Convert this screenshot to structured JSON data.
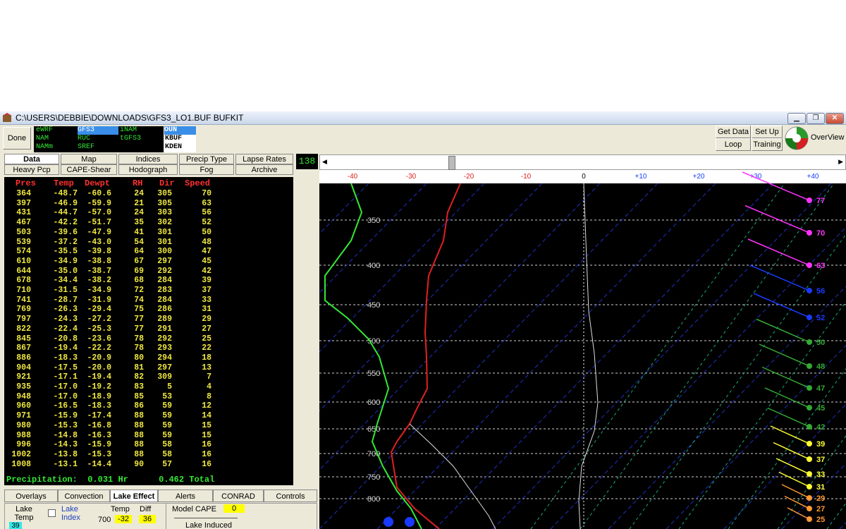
{
  "window": {
    "title": "C:\\USERS\\DEBBIE\\DOWNLOADS\\GFS3_LO1.BUF BUFKIT"
  },
  "toolbar": {
    "done": "Done",
    "get_data": "Get Data",
    "set_up": "Set Up",
    "loop": "Loop",
    "training": "Training",
    "overview": "OverView",
    "frame": "138"
  },
  "models": {
    "col1": [
      "eWRF",
      "NAM",
      "NAMm"
    ],
    "col2": [
      "GFS3",
      "RUC",
      "SREF"
    ],
    "col3": [
      "iNAM",
      "tGFS3"
    ],
    "stations": [
      "OUN",
      "KBUF",
      "KDEN"
    ]
  },
  "tabs_top": [
    "Data",
    "Map",
    "Indices",
    "Precip Type",
    "Lapse Rates"
  ],
  "tabs_bottom": [
    "Heavy Pcp",
    "CAPE-Shear",
    "Hodograph",
    "Fog",
    "Archive"
  ],
  "table": {
    "headers": [
      "Pres",
      "Temp",
      "Dewpt",
      "RH",
      "Dir",
      "Speed"
    ],
    "rows": [
      [
        "364",
        "-48.7",
        "-60.6",
        "24",
        "305",
        "70"
      ],
      [
        "397",
        "-46.9",
        "-59.9",
        "21",
        "305",
        "63"
      ],
      [
        "431",
        "-44.7",
        "-57.0",
        "24",
        "303",
        "56"
      ],
      [
        "467",
        "-42.2",
        "-51.7",
        "35",
        "302",
        "52"
      ],
      [
        "503",
        "-39.6",
        "-47.9",
        "41",
        "301",
        "50"
      ],
      [
        "539",
        "-37.2",
        "-43.0",
        "54",
        "301",
        "48"
      ],
      [
        "574",
        "-35.5",
        "-39.8",
        "64",
        "300",
        "47"
      ],
      [
        "610",
        "-34.9",
        "-38.8",
        "67",
        "297",
        "45"
      ],
      [
        "644",
        "-35.0",
        "-38.7",
        "69",
        "292",
        "42"
      ],
      [
        "678",
        "-34.4",
        "-38.2",
        "68",
        "284",
        "39"
      ],
      [
        "710",
        "-31.5",
        "-34.9",
        "72",
        "283",
        "37"
      ],
      [
        "741",
        "-28.7",
        "-31.9",
        "74",
        "284",
        "33"
      ],
      [
        "769",
        "-26.3",
        "-29.4",
        "75",
        "286",
        "31"
      ],
      [
        "797",
        "-24.3",
        "-27.2",
        "77",
        "289",
        "29"
      ],
      [
        "822",
        "-22.4",
        "-25.3",
        "77",
        "291",
        "27"
      ],
      [
        "845",
        "-20.8",
        "-23.6",
        "78",
        "292",
        "25"
      ],
      [
        "867",
        "-19.4",
        "-22.2",
        "78",
        "293",
        "22"
      ],
      [
        "886",
        "-18.3",
        "-20.9",
        "80",
        "294",
        "18"
      ],
      [
        "904",
        "-17.5",
        "-20.0",
        "81",
        "297",
        "13"
      ],
      [
        "921",
        "-17.1",
        "-19.4",
        "82",
        "309",
        "7"
      ],
      [
        "935",
        "-17.0",
        "-19.2",
        "83",
        "5",
        "4"
      ],
      [
        "948",
        "-17.0",
        "-18.9",
        "85",
        "53",
        "8"
      ],
      [
        "960",
        "-16.5",
        "-18.3",
        "86",
        "59",
        "12"
      ],
      [
        "971",
        "-15.9",
        "-17.4",
        "88",
        "59",
        "14"
      ],
      [
        "980",
        "-15.3",
        "-16.8",
        "88",
        "59",
        "15"
      ],
      [
        "988",
        "-14.8",
        "-16.3",
        "88",
        "59",
        "15"
      ],
      [
        "996",
        "-14.3",
        "-15.9",
        "88",
        "58",
        "16"
      ],
      [
        "1002",
        "-13.8",
        "-15.3",
        "88",
        "58",
        "16"
      ],
      [
        "1008",
        "-13.1",
        "-14.4",
        "90",
        "57",
        "16"
      ]
    ],
    "precip_label": "Precipitation:",
    "precip_rate": "0.031 Hr",
    "precip_total": "0.462 Total"
  },
  "panel_tabs": [
    "Overlays",
    "Convection",
    "Lake Effect",
    "Alerts",
    "CONRAD",
    "Controls"
  ],
  "lake": {
    "lake_temp_label": "Lake Temp",
    "lake_temp_value": "39",
    "lake_index_label": "Lake Index",
    "temp_label": "Temp",
    "diff_label": "Diff",
    "level": "700",
    "temp_value": "-32",
    "diff_value": "36",
    "model_cape_label": "Model CAPE",
    "model_cape_value": "0",
    "lake_induced_label": "Lake Induced"
  },
  "skewt": {
    "temp_axis": [
      "-40",
      "-30",
      "-20",
      "-10",
      "0",
      "+10",
      "+20",
      "+30",
      "+40"
    ],
    "pressure_labels": [
      "350",
      "400",
      "450",
      "500",
      "550",
      "600",
      "650",
      "700",
      "750",
      "800"
    ],
    "wind_speed_labels": [
      "77",
      "70",
      "63",
      "56",
      "52",
      "50",
      "48",
      "47",
      "45",
      "42",
      "39",
      "37",
      "33",
      "31",
      "29",
      "27",
      "25"
    ],
    "colors": {
      "temp": "#e02020",
      "dewpt": "#33e833",
      "background": "#000000"
    }
  }
}
